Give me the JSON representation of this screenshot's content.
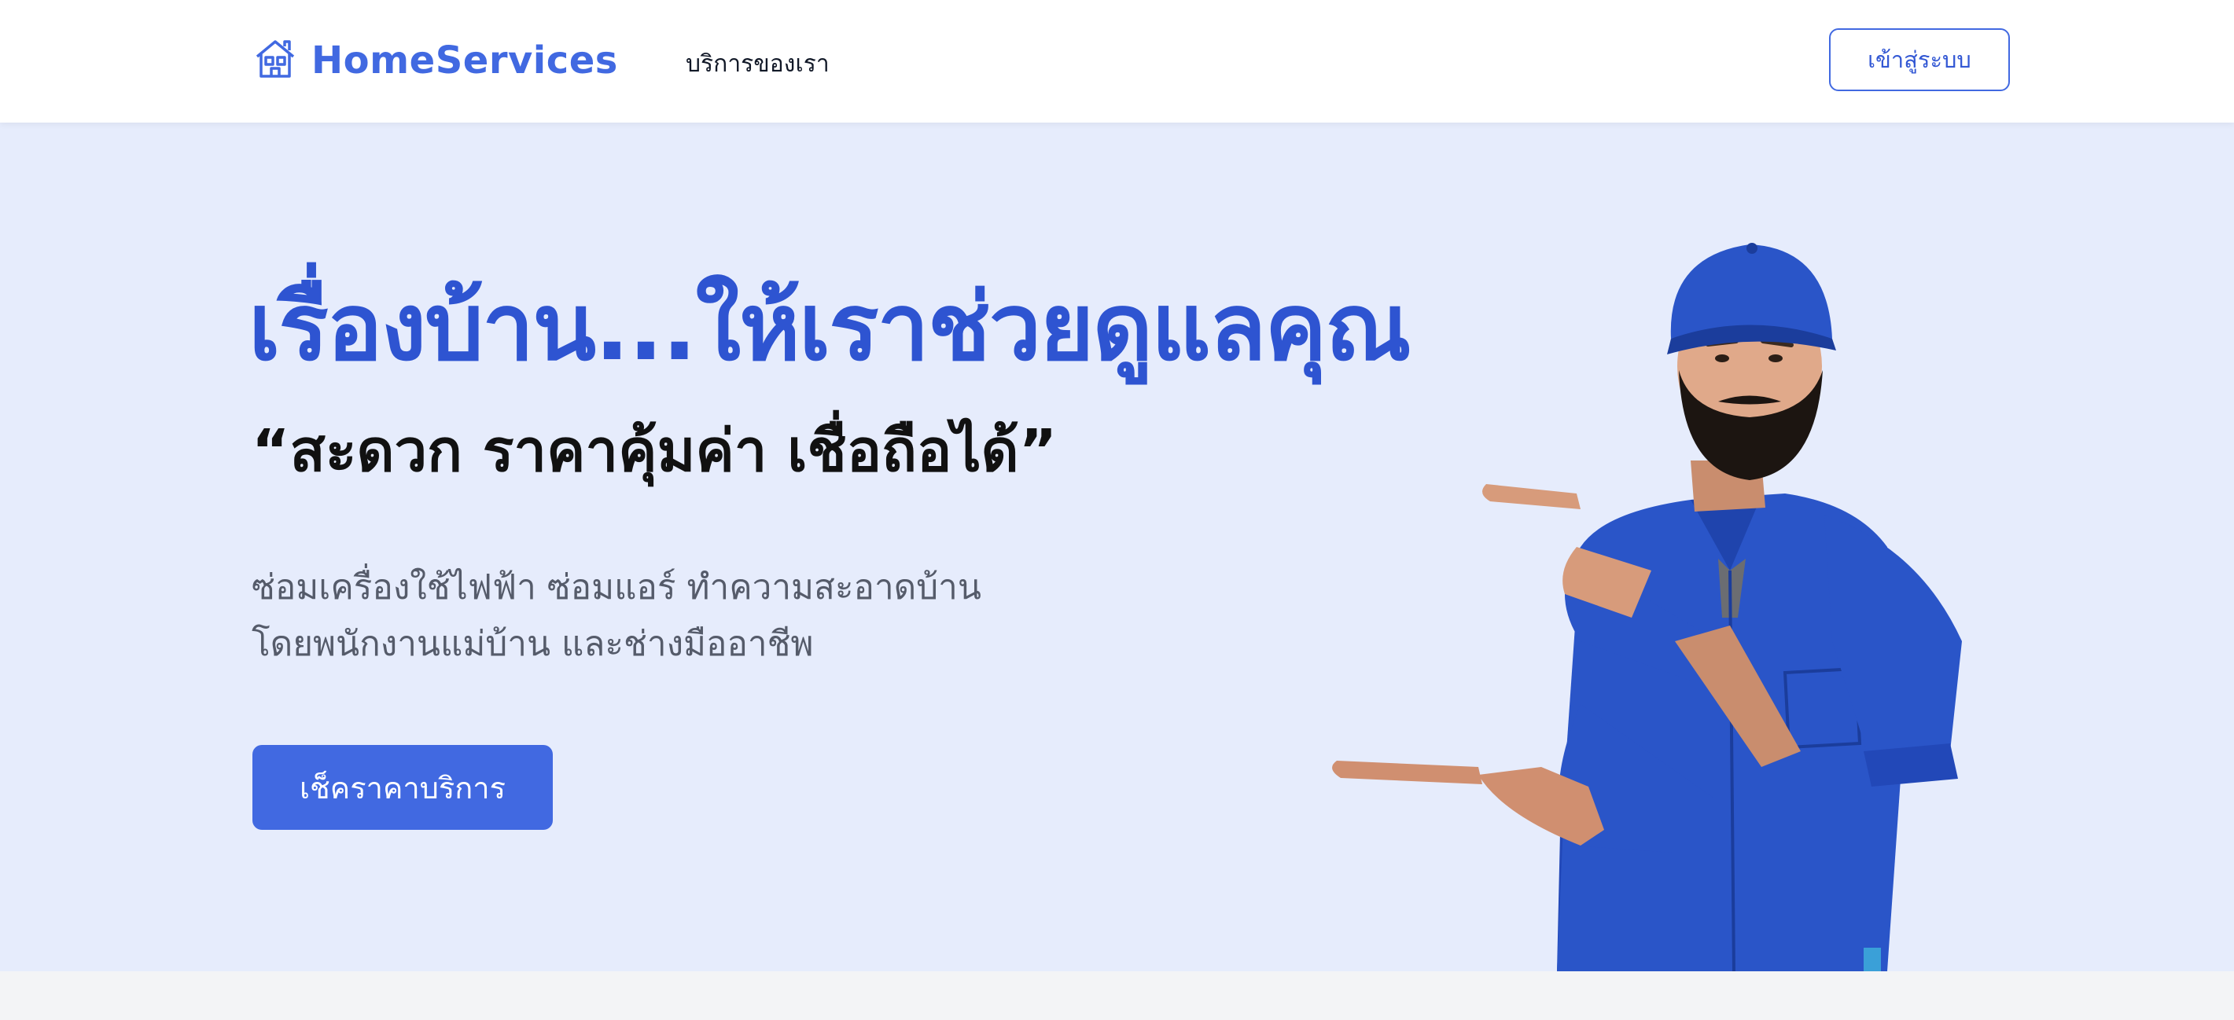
{
  "navbar": {
    "brand_name": "HomeServices",
    "brand_icon": "house-icon",
    "nav_links": [
      "บริการของเรา"
    ],
    "login_label": "เข้าสู่ระบบ"
  },
  "hero": {
    "headline": "เรื่องบ้าน...ให้เราช่วยดูแลคุณ",
    "subheadline": "“สะดวก ราคาคุ้มค่า เชื่อถือได้”",
    "description_lines": [
      "ซ่อมเครื่องใช้ไฟฟ้า ซ่อมแอร์ ทำความสะอาดบ้าน",
      "โดยพนักงานแม่บ้าน และช่างมืออาชีพ"
    ],
    "cta_label": "เช็คราคาบริการ"
  },
  "colors": {
    "accent": "#4169e1",
    "headline": "#2e54d1",
    "hero_background": "#e6ecfc",
    "worker_uniform": "#2a55c8"
  }
}
